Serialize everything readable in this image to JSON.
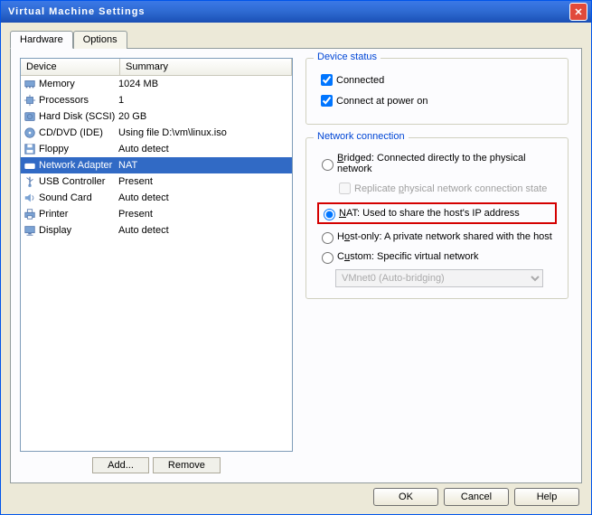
{
  "title": "Virtual Machine Settings",
  "tabs": {
    "hardware": "Hardware",
    "options": "Options"
  },
  "headers": {
    "device": "Device",
    "summary": "Summary"
  },
  "devices": [
    {
      "name": "Memory",
      "summary": "1024 MB",
      "icon": "memory"
    },
    {
      "name": "Processors",
      "summary": "1",
      "icon": "cpu"
    },
    {
      "name": "Hard Disk (SCSI)",
      "summary": "20 GB",
      "icon": "hdd"
    },
    {
      "name": "CD/DVD (IDE)",
      "summary": "Using file D:\\vm\\linux.iso",
      "icon": "cd"
    },
    {
      "name": "Floppy",
      "summary": "Auto detect",
      "icon": "floppy"
    },
    {
      "name": "Network Adapter",
      "summary": "NAT",
      "icon": "net",
      "selected": true
    },
    {
      "name": "USB Controller",
      "summary": "Present",
      "icon": "usb"
    },
    {
      "name": "Sound Card",
      "summary": "Auto detect",
      "icon": "sound"
    },
    {
      "name": "Printer",
      "summary": "Present",
      "icon": "printer"
    },
    {
      "name": "Display",
      "summary": "Auto detect",
      "icon": "display"
    }
  ],
  "status": {
    "title": "Device status",
    "connected": "Connected",
    "connect_power": "Connect at power on"
  },
  "network": {
    "title": "Network connection",
    "bridged": "ridged: Connected directly to the physical network",
    "bridged_key": "B",
    "replicate": "Replicate ",
    "replicate_key": "p",
    "replicate_rest": "hysical network connection state",
    "nat_key": "N",
    "nat": "AT: Used to share the host's IP address",
    "hostonly_key": "o",
    "hostonly_pre": "H",
    "hostonly": "st-only: A private network shared with the host",
    "custom_key": "u",
    "custom_pre": "C",
    "custom": "stom: Specific virtual network",
    "vmnet": "VMnet0 (Auto-bridging)"
  },
  "panel_buttons": {
    "add": "Add...",
    "remove": "Remove"
  },
  "buttons": {
    "ok": "OK",
    "cancel": "Cancel",
    "help": "Help"
  }
}
